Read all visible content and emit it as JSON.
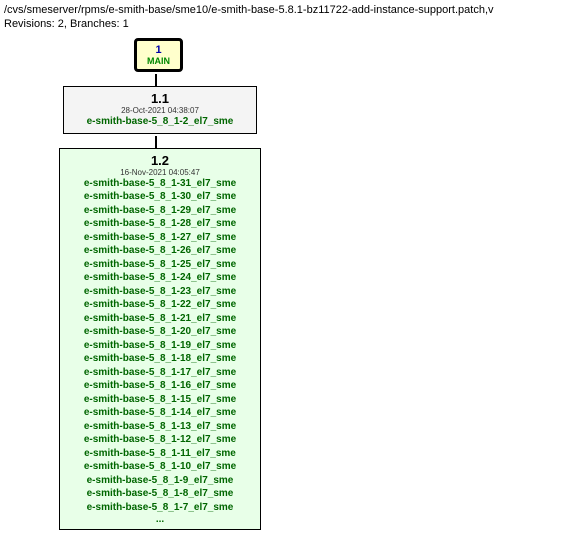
{
  "header": {
    "path": "/cvs/smeserver/rpms/e-smith-base/sme10/e-smith-base-5.8.1-bz11722-add-instance-support.patch,v",
    "stats": "Revisions: 2, Branches: 1"
  },
  "main_branch": {
    "num": "1",
    "label": "MAIN"
  },
  "rev11": {
    "num": "1.1",
    "date": "28-Oct-2021 04:38:07",
    "tag": "e-smith-base-5_8_1-2_el7_sme"
  },
  "rev12": {
    "num": "1.2",
    "date": "16-Nov-2021 04:05:47",
    "tags": [
      "e-smith-base-5_8_1-31_el7_sme",
      "e-smith-base-5_8_1-30_el7_sme",
      "e-smith-base-5_8_1-29_el7_sme",
      "e-smith-base-5_8_1-28_el7_sme",
      "e-smith-base-5_8_1-27_el7_sme",
      "e-smith-base-5_8_1-26_el7_sme",
      "e-smith-base-5_8_1-25_el7_sme",
      "e-smith-base-5_8_1-24_el7_sme",
      "e-smith-base-5_8_1-23_el7_sme",
      "e-smith-base-5_8_1-22_el7_sme",
      "e-smith-base-5_8_1-21_el7_sme",
      "e-smith-base-5_8_1-20_el7_sme",
      "e-smith-base-5_8_1-19_el7_sme",
      "e-smith-base-5_8_1-18_el7_sme",
      "e-smith-base-5_8_1-17_el7_sme",
      "e-smith-base-5_8_1-16_el7_sme",
      "e-smith-base-5_8_1-15_el7_sme",
      "e-smith-base-5_8_1-14_el7_sme",
      "e-smith-base-5_8_1-13_el7_sme",
      "e-smith-base-5_8_1-12_el7_sme",
      "e-smith-base-5_8_1-11_el7_sme",
      "e-smith-base-5_8_1-10_el7_sme",
      "e-smith-base-5_8_1-9_el7_sme",
      "e-smith-base-5_8_1-8_el7_sme",
      "e-smith-base-5_8_1-7_el7_sme"
    ],
    "ellipsis": "..."
  }
}
